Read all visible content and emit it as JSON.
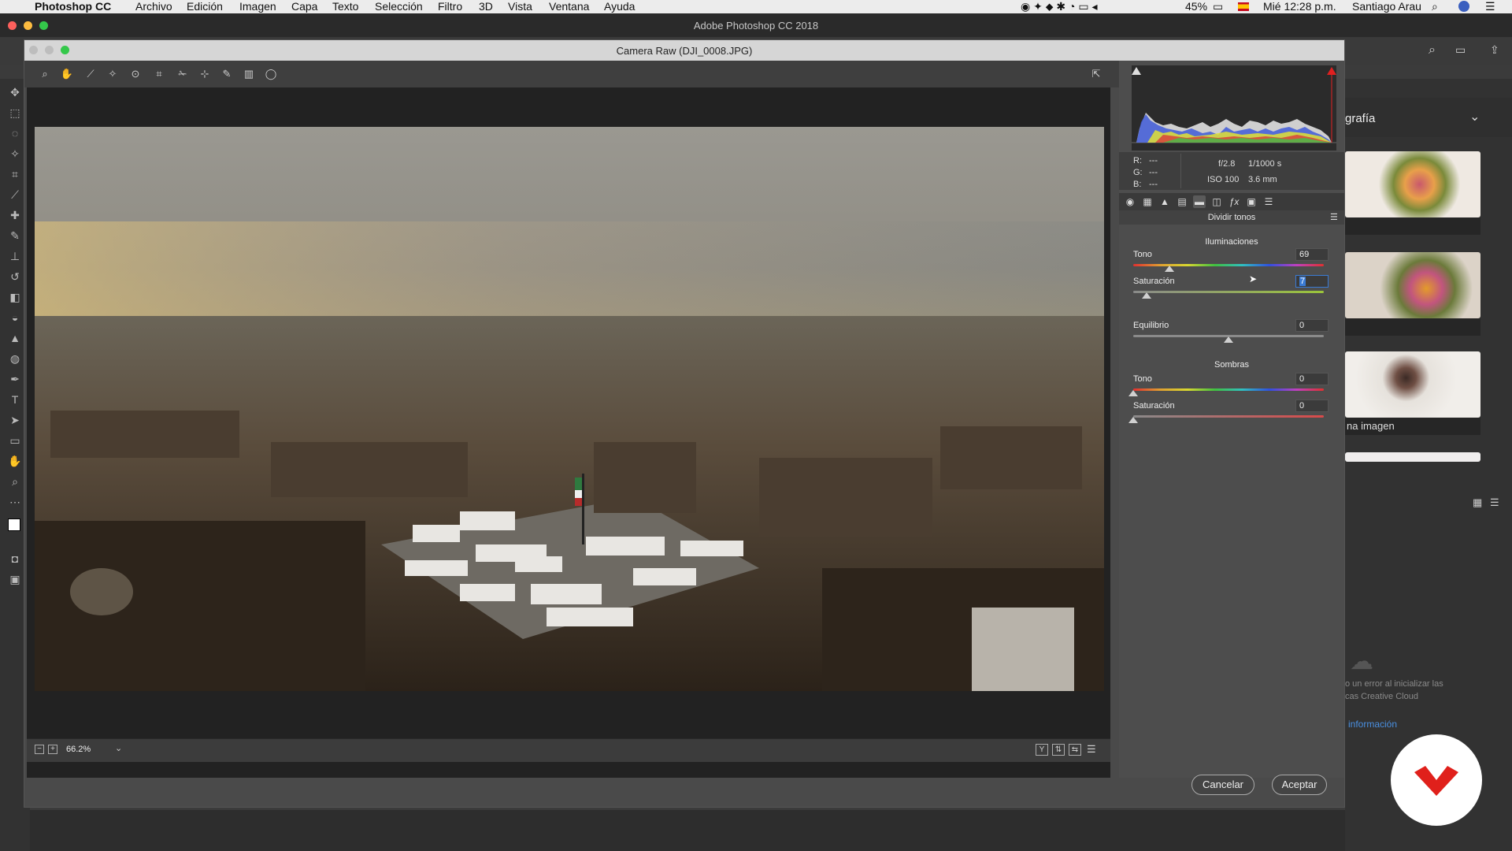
{
  "menubar": {
    "app": "Photoshop CC",
    "items": [
      "Archivo",
      "Edición",
      "Imagen",
      "Capa",
      "Texto",
      "Selección",
      "Filtro",
      "3D",
      "Vista",
      "Ventana",
      "Ayuda"
    ],
    "battery": "45%",
    "datetime": "Mié 12:28 p.m.",
    "user": "Santiago Arau"
  },
  "ps_window": {
    "title": "Adobe Photoshop CC 2018"
  },
  "camera_raw": {
    "title": "Camera Raw (DJI_0008.JPG)",
    "zoom": "66.2%",
    "rgb": {
      "r_label": "R:",
      "g_label": "G:",
      "b_label": "B:",
      "r": "---",
      "g": "---",
      "b": "---"
    },
    "exif": {
      "aperture": "f/2.8",
      "shutter": "1/1000 s",
      "iso": "ISO 100",
      "focal": "3.6 mm"
    },
    "panel_title": "Dividir tonos",
    "highlights": {
      "title": "Iluminaciones",
      "hue_label": "Tono",
      "hue": "69",
      "hue_frac": 0.19,
      "sat_label": "Saturación",
      "sat": "7",
      "sat_frac": 0.07
    },
    "balance": {
      "label": "Equilibrio",
      "value": "0",
      "frac": 0.5
    },
    "shadows": {
      "title": "Sombras",
      "hue_label": "Tono",
      "hue": "0",
      "hue_frac": 0,
      "sat_label": "Saturación",
      "sat": "0",
      "sat_frac": 0
    },
    "cancel": "Cancelar",
    "accept": "Aceptar"
  },
  "right_panel": {
    "header": "grafía",
    "caption3": "na imagen",
    "cc_error": "o un error al inicializar las",
    "cc_error2": "cas Creative Cloud",
    "more_info": "información"
  },
  "colors": {
    "accent": "#3a7bd5",
    "badge_red": "#e0201b"
  }
}
